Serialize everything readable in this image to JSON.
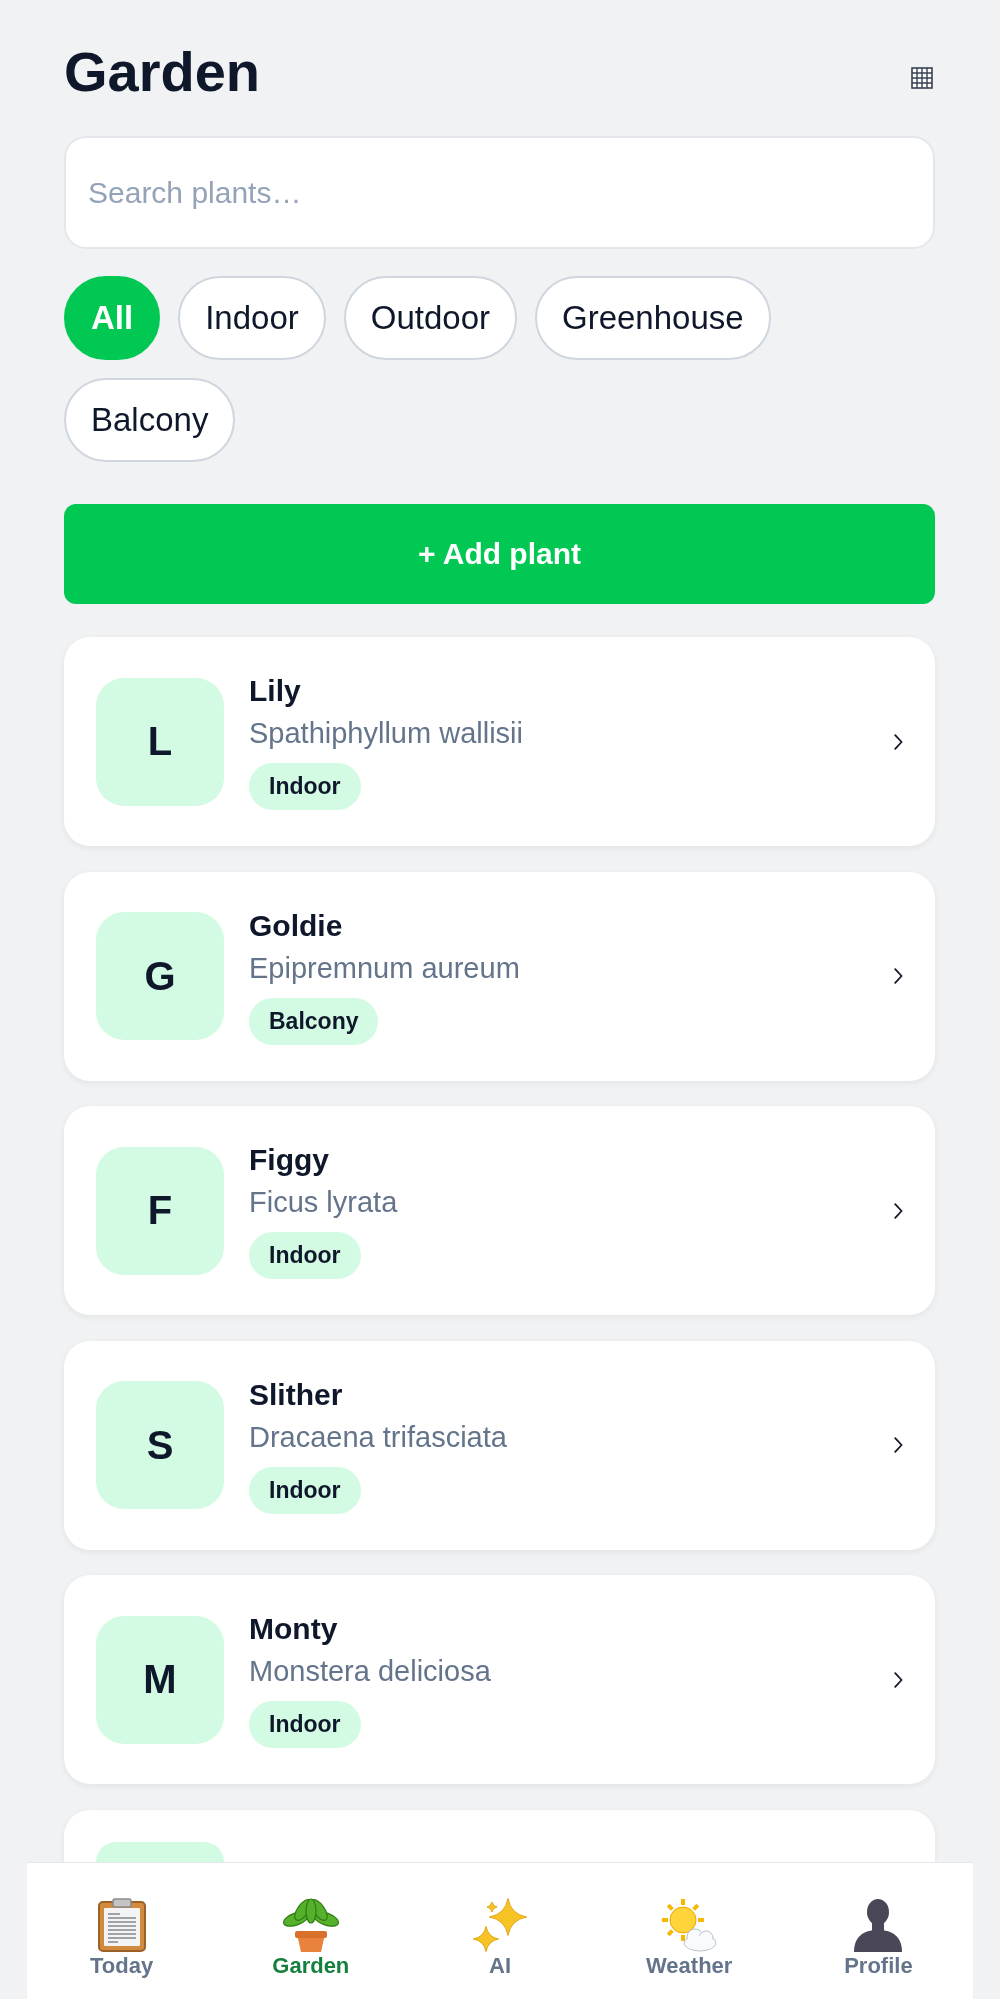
{
  "header": {
    "title": "Garden"
  },
  "search": {
    "placeholder": "Search plants…"
  },
  "filters": [
    {
      "label": "All",
      "selected": true
    },
    {
      "label": "Indoor",
      "selected": false
    },
    {
      "label": "Outdoor",
      "selected": false
    },
    {
      "label": "Greenhouse",
      "selected": false
    },
    {
      "label": "Balcony",
      "selected": false
    }
  ],
  "add_button": {
    "label": "+ Add plant"
  },
  "plants": [
    {
      "initial": "L",
      "name": "Lily",
      "species": "Spathiphyllum wallisii",
      "tag": "Indoor"
    },
    {
      "initial": "G",
      "name": "Goldie",
      "species": "Epipremnum aureum",
      "tag": "Balcony"
    },
    {
      "initial": "F",
      "name": "Figgy",
      "species": "Ficus lyrata",
      "tag": "Indoor"
    },
    {
      "initial": "S",
      "name": "Slither",
      "species": "Dracaena trifasciata",
      "tag": "Indoor"
    },
    {
      "initial": "M",
      "name": "Monty",
      "species": "Monstera deliciosa",
      "tag": "Indoor"
    }
  ],
  "more_plants_below": true,
  "bottom_nav": [
    {
      "label": "Today",
      "selected": false
    },
    {
      "label": "Garden",
      "selected": true
    },
    {
      "label": "AI",
      "selected": false
    },
    {
      "label": "Weather",
      "selected": false
    },
    {
      "label": "Profile",
      "selected": false
    }
  ]
}
